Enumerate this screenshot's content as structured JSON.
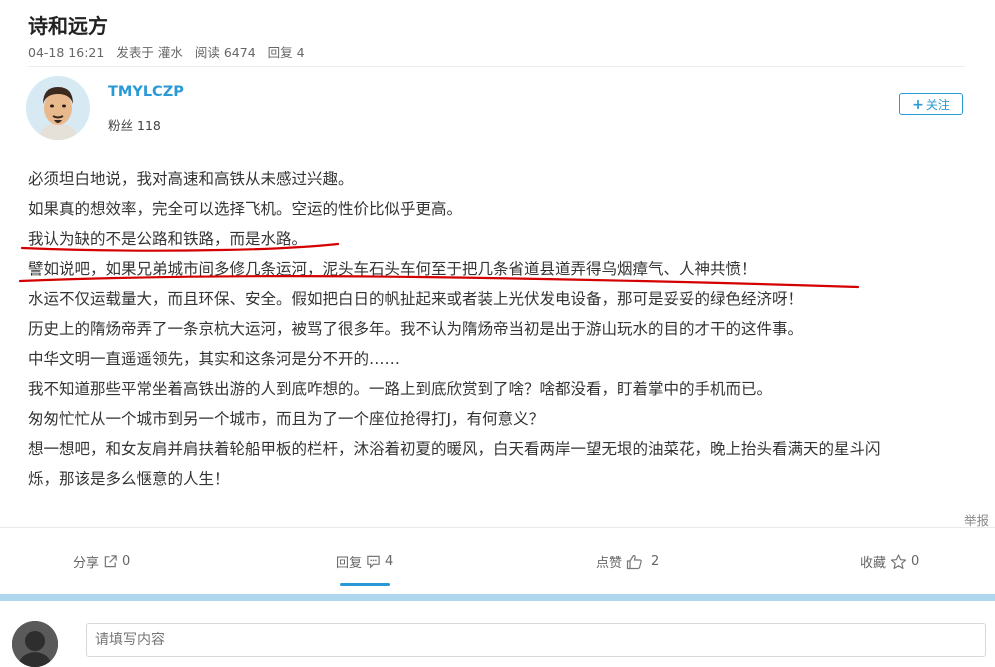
{
  "post": {
    "title": "诗和远方",
    "meta": {
      "time": "04-18 16:21",
      "posted_in_prefix": "发表于",
      "board": "灌水",
      "views_label": "阅读",
      "views": "6474",
      "replies_label": "回复",
      "replies": "4"
    }
  },
  "author": {
    "name": "TMYLCZP",
    "fans_label": "粉丝",
    "fans": "118",
    "follow_label": "关注"
  },
  "content_lines": [
    "必须坦白地说，我对高速和高铁从未感过兴趣。",
    "如果真的想效率，完全可以选择飞机。空运的性价比似乎更高。",
    "我认为缺的不是公路和铁路，而是水路。",
    "譬如说吧，如果兄弟城市间多修几条运河，泥头车石头车何至于把几条省道县道弄得乌烟瘴气、人神共愤！",
    "水运不仅运载量大，而且环保、安全。假如把白日的帆扯起来或者装上光伏发电设备，那可是妥妥的绿色经济呀！",
    "历史上的隋炀帝弄了一条京杭大运河，被骂了很多年。我不认为隋炀帝当初是出于游山玩水的目的才干的这件事。",
    "中华文明一直遥遥领先，其实和这条河是分不开的……",
    "我不知道那些平常坐着高铁出游的人到底咋想的。一路上到底欣赏到了啥？啥都没看，盯着掌中的手机而已。",
    "匆匆忙忙从一个城市到另一个城市，而且为了一个座位抢得打J，有何意义？",
    "想一想吧，和女友肩并肩扶着轮船甲板的栏杆，沐浴着初夏的暖风，白天看两岸一望无垠的油菜花，晚上抬头看满天的星斗闪",
    "烁，那该是多么惬意的人生！"
  ],
  "report_label": "举报",
  "actions": {
    "share": {
      "label": "分享",
      "count": "0"
    },
    "reply": {
      "label": "回复",
      "count": "4"
    },
    "like": {
      "label": "点赞",
      "count": "2"
    },
    "favorite": {
      "label": "收藏",
      "count": "0"
    }
  },
  "reply_box": {
    "placeholder": "请填写内容"
  },
  "colors": {
    "accent": "#2a9ad6",
    "annotation_red": "#d40000",
    "bar": "#aed7ee"
  }
}
